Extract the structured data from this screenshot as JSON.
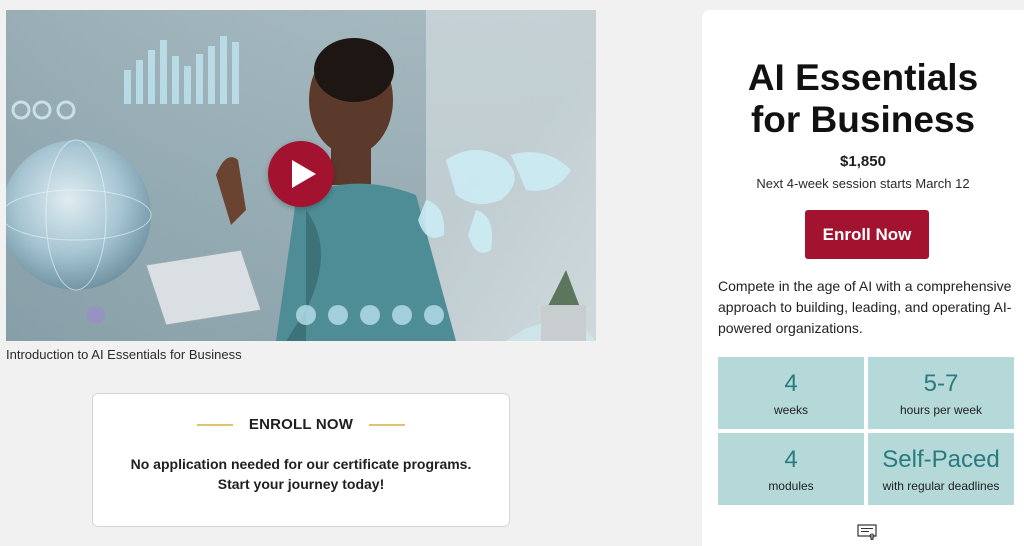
{
  "video": {
    "caption": "Introduction to AI Essentials for Business",
    "play_icon": "play-icon"
  },
  "enroll_box": {
    "heading": "ENROLL NOW",
    "line1": "No application needed for our certificate programs.",
    "line2": "Start your journey today!"
  },
  "course": {
    "title_line1": "AI Essentials",
    "title_line2": "for Business",
    "price": "$1,850",
    "session": "Next 4-week session starts March 12",
    "enroll_label": "Enroll Now",
    "description": "Compete in the age of AI with a comprehensive approach to building, leading, and operating AI-powered organizations.",
    "stats": [
      {
        "value": "4",
        "label": "weeks"
      },
      {
        "value": "5-7",
        "label": "hours per week"
      },
      {
        "value": "4",
        "label": "modules"
      },
      {
        "value": "Self-Paced",
        "label": "with regular deadlines"
      }
    ],
    "footer_icon": "certificate-icon"
  },
  "colors": {
    "accent": "#a3132f",
    "stat_bg": "#b5d8d8",
    "stat_value": "#2a7b80",
    "gold": "#e1c26d"
  }
}
